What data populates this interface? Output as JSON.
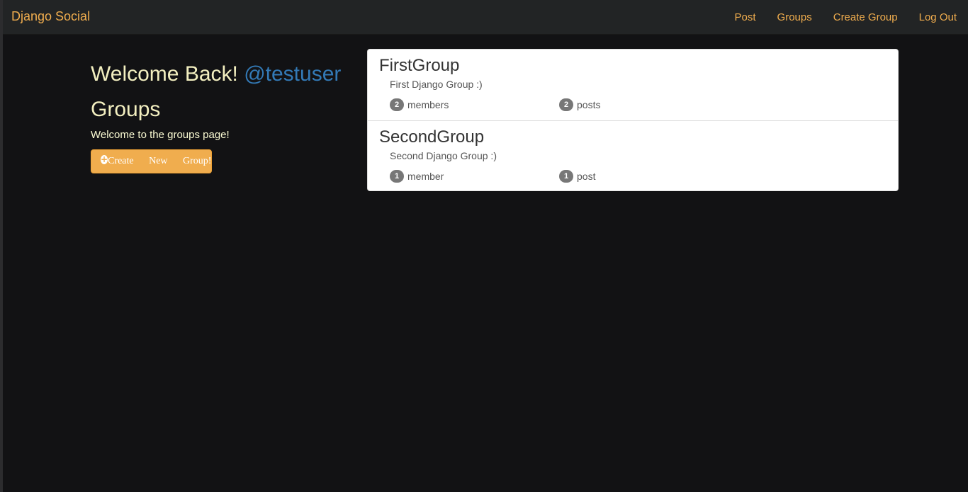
{
  "navbar": {
    "brand": "Django Social",
    "links": [
      "Post",
      "Groups",
      "Create Group",
      "Log Out"
    ],
    "link_color": "#f0ad4e"
  },
  "welcome": {
    "greeting": "Welcome Back!",
    "username": "@testuser"
  },
  "groups_page": {
    "title": "Groups",
    "subtitle": "Welcome to the groups page!",
    "create_button": {
      "icon": "plus-circle-icon",
      "label": "Create New Group!"
    }
  },
  "groups": [
    {
      "name": "FirstGroup",
      "description": "First Django Group :)",
      "member_count": "2",
      "member_label": "members",
      "post_count": "2",
      "post_label": "posts"
    },
    {
      "name": "SecondGroup",
      "description": "Second Django Group :)",
      "member_count": "1",
      "member_label": "member",
      "post_count": "1",
      "post_label": "post"
    }
  ],
  "colors": {
    "background": "#121214",
    "navbar": "#222425",
    "accent": "#f0ad4e",
    "heading": "#f3efc0",
    "username": "#337ab7",
    "badge": "#777777"
  }
}
